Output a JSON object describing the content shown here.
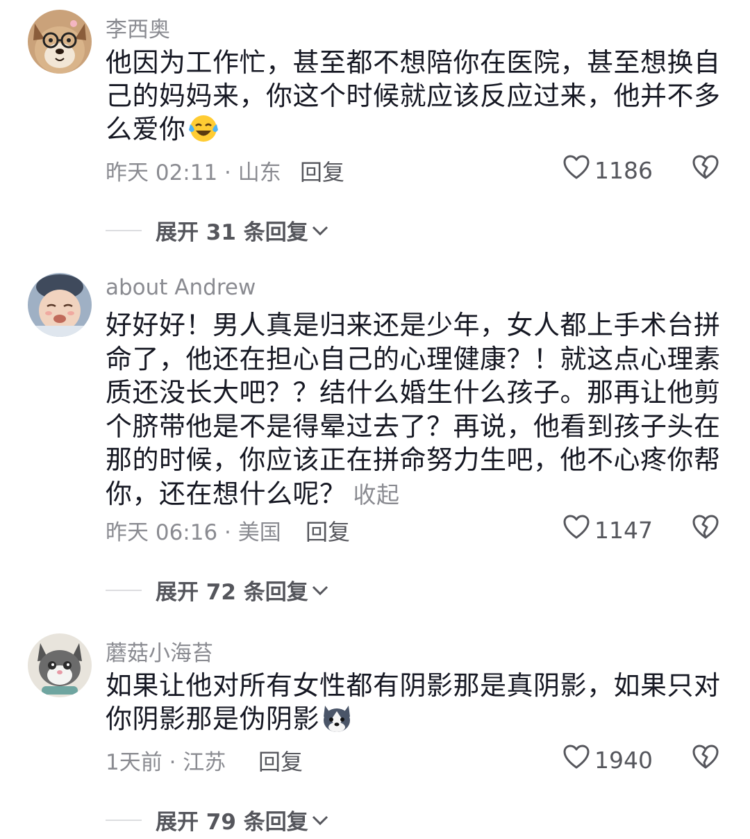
{
  "comments": [
    {
      "username": "李西奥",
      "text": "他因为工作忙，甚至都不想陪你在医院，甚至想换自己的妈妈来，你这个时候就应该反应过来，他并不多么爱你",
      "emoji": "laughing-crying-emoji",
      "time_location": "昨天 02:11 · 山东",
      "reply_label": "回复",
      "likes": "1186",
      "expand_label": "展开 31 条回复"
    },
    {
      "username": "about Andrew",
      "text": "好好好！男人真是归来还是少年，女人都上手术台拼命了，他还在担心自己的心理健康？！就这点心理素质还没长大吧？？结什么婚生什么孩子。那再让他剪个脐带他是不是得晕过去了？再说，他看到孩子头在那的时候，你应该正在拼命努力生吧，他不心疼你帮你，还在想什么呢？",
      "collapse_label": "收起",
      "time_location": "昨天 06:16 · 美国",
      "reply_label": "回复",
      "likes": "1147",
      "expand_label": "展开 72 条回复"
    },
    {
      "username": "蘑菇小海苔",
      "text": "如果让他对所有女性都有阴影那是真阴影，如果只对你阴影那是伪阴影",
      "emoji": "husky-dog-emoji",
      "time_location": "1天前 · 江苏",
      "reply_label": "回复",
      "likes": "1940",
      "expand_label": "展开 79 条回复"
    }
  ],
  "colors": {
    "text": "#161823",
    "secondary": "#8a8b91",
    "action": "#55565c"
  }
}
